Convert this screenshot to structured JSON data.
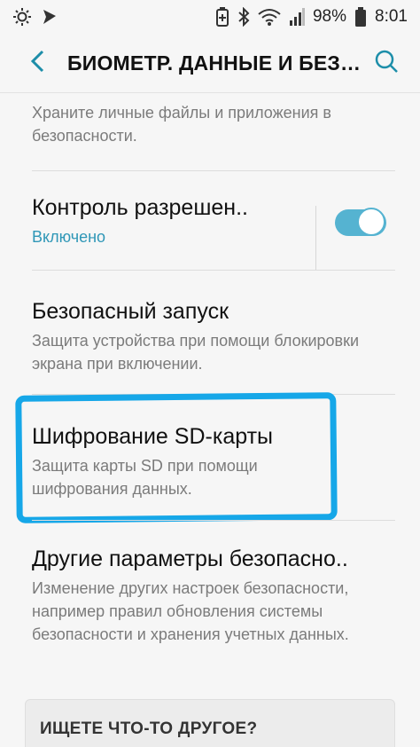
{
  "status_bar": {
    "battery_percent": "98%",
    "time": "8:01",
    "icons_left": [
      "brightness-icon",
      "nav-arrow-icon"
    ],
    "icons_right": [
      "battery-saver-icon",
      "bluetooth-icon",
      "wifi-icon",
      "signal-icon",
      "battery-icon"
    ]
  },
  "header": {
    "title": "БИОМЕТР. ДАННЫЕ И БЕЗ…",
    "back_icon": "chevron-left-icon",
    "search_icon": "search-icon"
  },
  "settings": {
    "items": [
      {
        "title": "",
        "subtitle": "Храните личные файлы и приложения в безопасности."
      },
      {
        "title": "Контроль разрешен..",
        "status": "Включено",
        "toggle_on": true
      },
      {
        "title": "Безопасный запуск",
        "subtitle": "Защита устройства при помощи блокировки экрана при включении."
      },
      {
        "title": "Шифрование SD-карты",
        "subtitle": "Защита карты SD при помощи шифрования данных."
      },
      {
        "title": "Другие параметры безопасно..",
        "subtitle": "Изменение других настроек безопасности, например правил обновления системы безопасности и хранения учетных данных."
      }
    ]
  },
  "other_card": {
    "title": "ИЩЕТЕ ЧТО-ТО ДРУГОЕ?"
  },
  "colors": {
    "accent": "#2f97b7",
    "toggle": "#55b3d1",
    "highlight": "#16a7e8"
  }
}
